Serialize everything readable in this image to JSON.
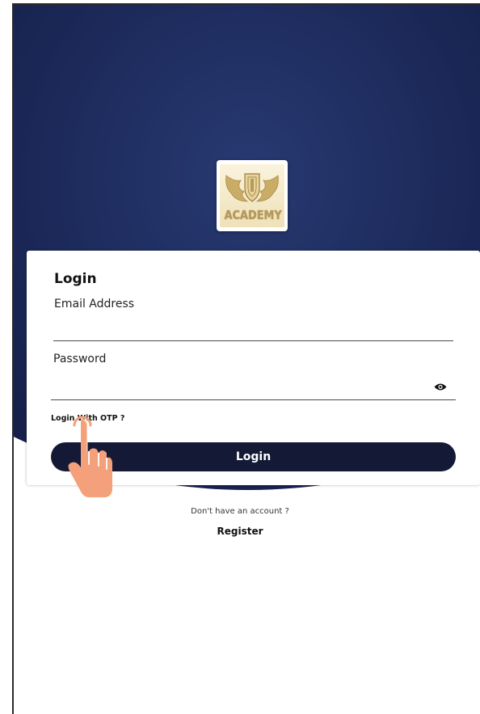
{
  "logo": {
    "text": "ACADEMY"
  },
  "login_form": {
    "title": "Login",
    "email_label": "Email Address",
    "email_value": "",
    "password_label": "Password",
    "password_value": "",
    "otp_link": "Login With OTP ?",
    "submit_label": "Login"
  },
  "footer": {
    "prompt": "Don't have an account ?",
    "register_label": "Register"
  },
  "colors": {
    "hero_navy": "#1b2858",
    "button_navy": "#141a36",
    "cursor_hand": "#f4a07a",
    "logo_gold": "#b59a5a"
  },
  "icons": {
    "password_toggle": "eye-icon",
    "cursor": "pointing-hand-icon"
  }
}
